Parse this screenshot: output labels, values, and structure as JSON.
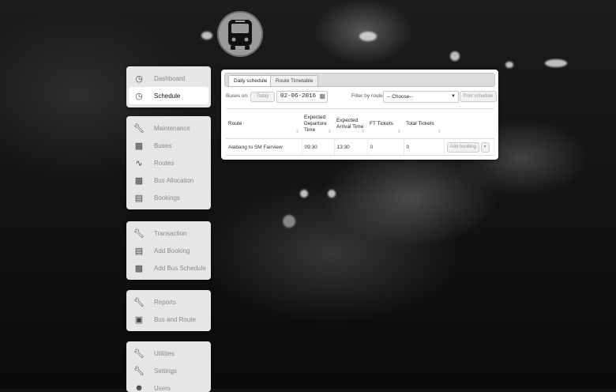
{
  "menu_groups": [
    {
      "items": [
        {
          "label": "Dashboard",
          "icon": "clock-icon"
        },
        {
          "label": "Schedule",
          "icon": "clock-icon",
          "active": true
        }
      ]
    },
    {
      "items": [
        {
          "label": "Maintenance",
          "icon": "wrench-icon"
        },
        {
          "label": "Buses",
          "icon": "bus-icon"
        },
        {
          "label": "Routes",
          "icon": "route-icon"
        },
        {
          "label": "Bus Allocation",
          "icon": "bus-icon"
        },
        {
          "label": "Bookings",
          "icon": "clipboard-icon"
        }
      ]
    },
    {
      "items": [
        {
          "label": "Transaction",
          "icon": "wrench-icon"
        },
        {
          "label": "Add Booking",
          "icon": "clipboard-icon"
        },
        {
          "label": "Add Bus Schedule",
          "icon": "bus-icon"
        }
      ]
    },
    {
      "items": [
        {
          "label": "Reports",
          "icon": "wrench-icon"
        },
        {
          "label": "Bus and Route",
          "icon": "presentation-icon"
        }
      ]
    },
    {
      "items": [
        {
          "label": "Utilities",
          "icon": "wrench-icon"
        },
        {
          "label": "Settings",
          "icon": "wrench-icon"
        },
        {
          "label": "Users",
          "icon": "users-icon"
        }
      ]
    }
  ],
  "tabs": {
    "daily": "Daily schedule",
    "timetable": "Route Timetable"
  },
  "controls": {
    "buses_on_label": "Buses on:",
    "today_button": "Today",
    "date_value": "02-06-2016",
    "filter_label": "Filter by route:",
    "route_select": "-- Choose--",
    "print_button": "Print schedule"
  },
  "table": {
    "headers": [
      "Route",
      "Expected Departure Time",
      "Expected Arrival Time",
      "FT Tickets",
      "Total Tickets",
      ""
    ],
    "rows": [
      {
        "route": "Alabang to SM Fairview",
        "departure": "09:30",
        "arrival": "13:30",
        "ft": "0",
        "total": "0",
        "action": "Add booking"
      }
    ]
  }
}
